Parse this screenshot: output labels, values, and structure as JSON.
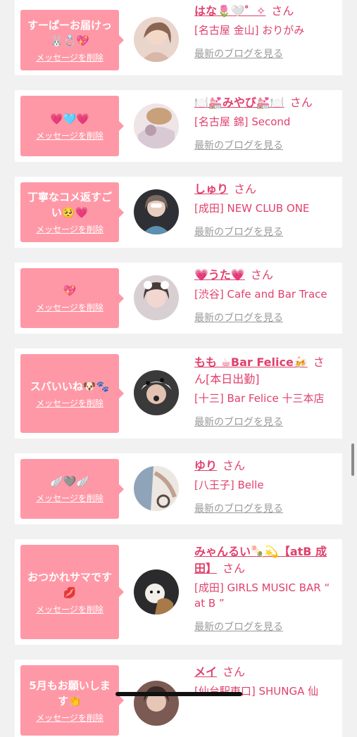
{
  "delete_label": "メッセージを削除",
  "blog_label": "最新のブログを見る",
  "san_label": "さん",
  "colors": {
    "accent": "#e0416d",
    "bubble": "#ff98a6",
    "background": "#f1f1f1"
  },
  "entries": [
    {
      "message": "すーぱーお届けっ🐰💍💖",
      "name": "はな🌷🤍゜✧",
      "name_after": "",
      "shop": "[名古屋 金山] おりがみ",
      "avatar_color": "#d8b7a8"
    },
    {
      "message": "💗🩵💗",
      "name": "🍽️💒みやび💒🍽️",
      "name_after": "",
      "shop": "[名古屋 錦] Second",
      "avatar_color": "#c9b4c6"
    },
    {
      "message": "丁寧なコメ返すごい🥺💗",
      "name": "しゅり",
      "name_after": "",
      "shop": "[成田] NEW CLUB ONE",
      "avatar_color": "#2f3035"
    },
    {
      "message": "💖",
      "name": "💗うた💗",
      "name_after": "",
      "shop": "[渋谷] Cafe and Bar Trace",
      "avatar_color": "#bfa4a8"
    },
    {
      "message": "スバいいね🐶🐾",
      "name": "もも ☕Bar Felice🍻",
      "name_after": "[本日出勤]",
      "shop": "[十三] Bar Felice 十三本店",
      "avatar_color": "#3a3a3a"
    },
    {
      "message": "🪽🩶🪽",
      "name": "ゆり",
      "name_after": "",
      "shop": "[八王子] Belle",
      "avatar_color": "#9d8e86"
    },
    {
      "message": "おつかれサマです💋",
      "name": "みゃんるい🍡💫【atB 成田】",
      "name_after": "",
      "shop": "[成田] GIRLS MUSIC BAR “ at B ”",
      "avatar_color": "#2b2b2e"
    },
    {
      "message": "5月もお願いします👏",
      "name": "メイ",
      "name_after": "",
      "shop": "[仙台駅東口] SHUNGA 仙",
      "avatar_color": "#7a5a52"
    }
  ]
}
